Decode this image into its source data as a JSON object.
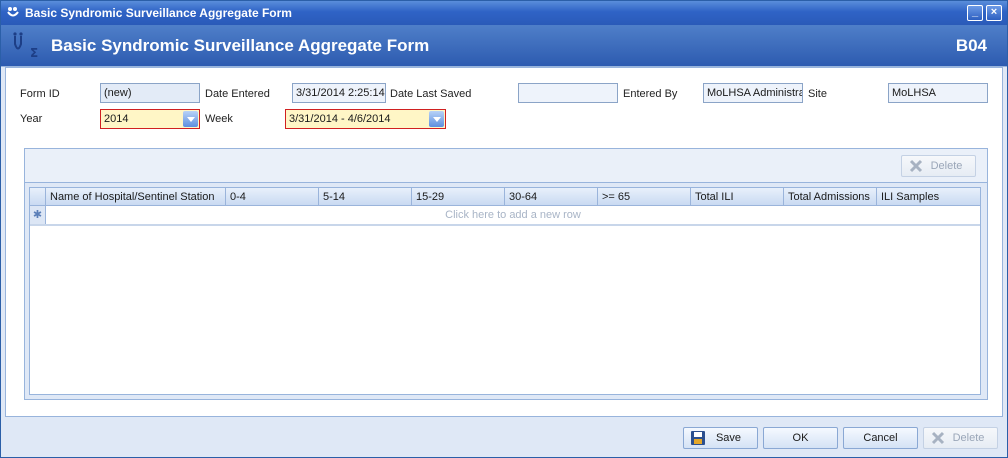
{
  "window": {
    "title": "Basic Syndromic Surveillance Aggregate Form"
  },
  "header": {
    "title": "Basic Syndromic Surveillance Aggregate Form",
    "code": "B04"
  },
  "form": {
    "form_id": {
      "label": "Form ID",
      "value": "(new)"
    },
    "date_entered": {
      "label": "Date Entered",
      "value": "3/31/2014 2:25:14"
    },
    "date_last_saved": {
      "label": "Date Last Saved",
      "value": ""
    },
    "entered_by": {
      "label": "Entered By",
      "value": "MoLHSA Administra"
    },
    "site": {
      "label": "Site",
      "value": "MoLHSA"
    },
    "year": {
      "label": "Year",
      "value": "2014"
    },
    "week": {
      "label": "Week",
      "value": "3/31/2014 - 4/6/2014"
    }
  },
  "grid": {
    "delete_label": "Delete",
    "columns": [
      "Name of Hospital/Sentinel Station",
      "0-4",
      "5-14",
      "15-29",
      "30-64",
      ">= 65",
      "Total ILI",
      "Total Admissions",
      "ILI Samples"
    ],
    "new_row_star": "✱",
    "new_row_hint": "Click here to add a new row"
  },
  "footer": {
    "save": "Save",
    "ok": "OK",
    "cancel": "Cancel",
    "delete": "Delete"
  },
  "icons": {
    "title": "app-icon",
    "minimize": "minimize-icon",
    "close": "close-icon",
    "save": "floppy-disk-icon",
    "delete": "delete-x-icon"
  },
  "colors": {
    "accent": "#2f63c6",
    "required_border": "#d02020",
    "required_fill": "#fff6c6"
  }
}
